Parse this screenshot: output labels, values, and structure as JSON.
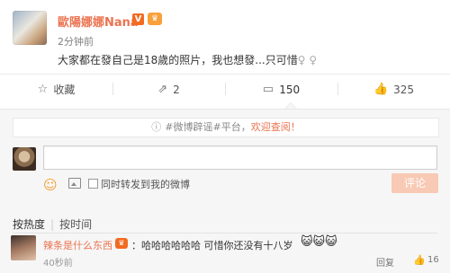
{
  "post": {
    "username": "歐陽娜娜Nana",
    "verified_badge": "V",
    "level_badge": "♛",
    "timestamp": "2分钟前",
    "text": "大家都在發自己是18歲的照片，我也想發...只可惜",
    "text_tail": "♀ ♀"
  },
  "actions": {
    "favorite": {
      "icon": "star-icon",
      "label": "收藏"
    },
    "repost": {
      "icon": "repost-icon",
      "label": "2"
    },
    "comment": {
      "icon": "comment-icon",
      "label": "150"
    },
    "like": {
      "icon": "thumbs-up-icon",
      "label": "325"
    }
  },
  "comment_box": {
    "notice_prefix": "#微博辟谣#平台，",
    "notice_link": "欢迎查阅！",
    "input_value": "",
    "repost_checkbox_label": "同时转发到我的微博",
    "submit_label": "评论"
  },
  "sort": {
    "hot": "按热度",
    "separator": "|",
    "time": "按时间"
  },
  "comments": [
    {
      "name": "辣条是什么东西",
      "badge": "♛",
      "text": "：哈哈哈哈哈哈 可惜你还没有十八岁",
      "emojis": "😺😺😺",
      "time": "40秒前",
      "reply_label": "回复",
      "likes": "16"
    }
  ],
  "colors": {
    "accent": "#eb7350",
    "submit_disabled": "#f8c9b4"
  }
}
